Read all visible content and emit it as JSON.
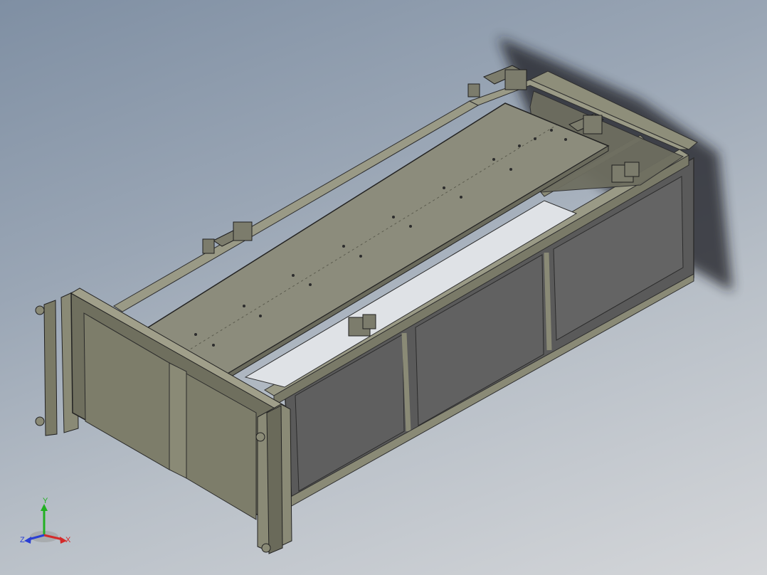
{
  "viewport": {
    "background_top": "#7f8fa3",
    "background_bottom": "#d4d6d9"
  },
  "model": {
    "frame_color": "#8a8a76",
    "frame_dark": "#5c5c50",
    "panel_color": "#5e5e5e",
    "plate_color": "#8c8c7c",
    "end_panel_color": "#7a7a66"
  },
  "triad": {
    "x_label": "X",
    "y_label": "Y",
    "z_label": "Z",
    "x_color": "#d42a2a",
    "y_color": "#22b022",
    "z_color": "#2a3fd4"
  }
}
